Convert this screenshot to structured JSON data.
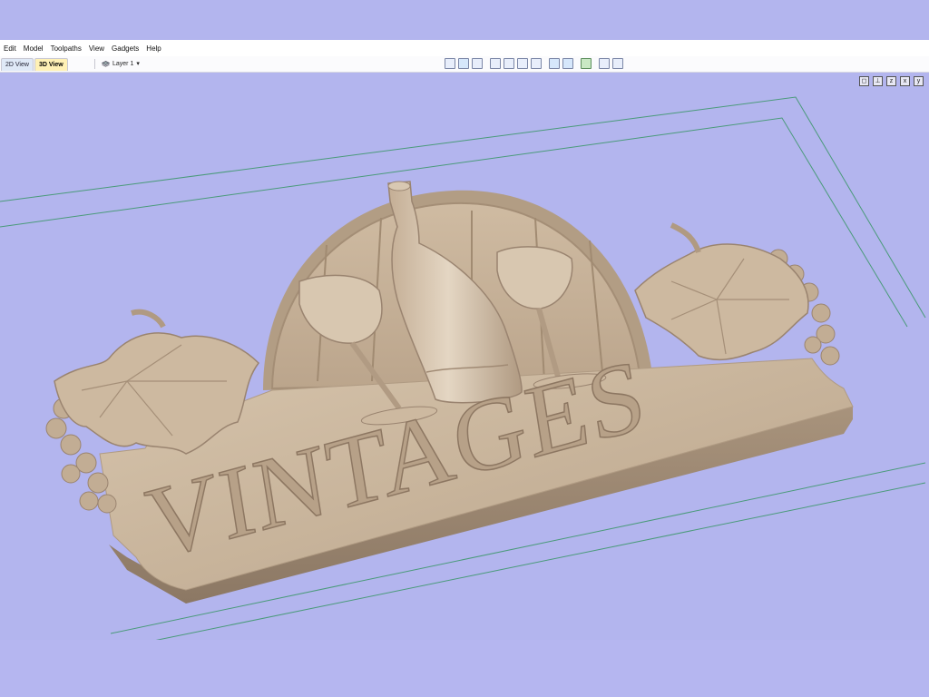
{
  "menu": {
    "items": [
      "Edit",
      "Model",
      "Toolpaths",
      "View",
      "Gadgets",
      "Help"
    ]
  },
  "toolbar": {
    "tab_2d": "2D View",
    "tab_3d": "3D View",
    "layer_label": "Layer 1",
    "layer_arrow": "▾"
  },
  "viewport": {
    "sign_text": "VINTAGES",
    "view_icons": [
      "fit-view-icon",
      "iso-view-icon",
      "z-axis-view-icon",
      "x-axis-view-icon",
      "y-axis-view-icon"
    ]
  },
  "colors": {
    "background": "#b3b5ee",
    "wood": "#c9b59d",
    "wood_dark": "#9d8874",
    "wood_light": "#e2d3c0",
    "boundary_line": "#4a9a7a"
  }
}
